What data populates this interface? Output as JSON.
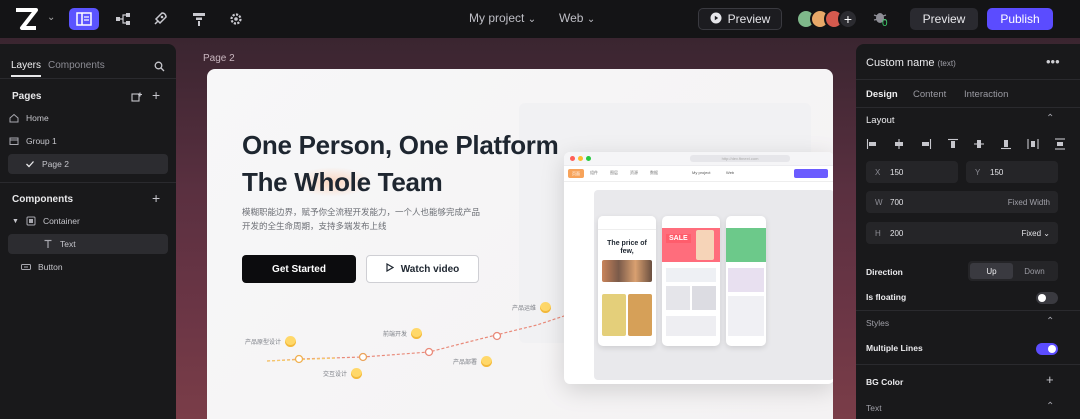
{
  "topbar": {
    "project_name": "My project",
    "platform": "Web",
    "preview_label": "Preview",
    "notification_count": "0",
    "preview_button_label": "Preview",
    "publish_label": "Publish",
    "avatar_add": "+"
  },
  "canvas": {
    "page_label": "Page 2"
  },
  "left_panel": {
    "tabs": [
      "Layers",
      "Components"
    ],
    "pages_title": "Pages",
    "pages": [
      "Home",
      "Group 1",
      "Page 2"
    ],
    "components_title": "Components",
    "components": [
      "Container",
      "Text",
      "Button"
    ]
  },
  "hero": {
    "title_line1": "One Person, One Platform",
    "title_line2_pre": "The ",
    "title_line2_glow": "Whole",
    "title_line2_post": " Team",
    "subtitle": "模糊职能边界，赋予你全流程开发能力，一个人也能够完成产品开发的全生命周期，支持多端发布上线",
    "start_button": "Get Started",
    "video_button": "Watch video"
  },
  "steps": [
    "产品原型设计",
    "交互设计",
    "前端开发",
    "产品部署",
    "产品运维"
  ],
  "mockup": {
    "url_text": "http://dev.fbnext.com",
    "toolbar_tabs": [
      "页面",
      "组件",
      "图层",
      "资源",
      "数据"
    ],
    "project": "My project",
    "web": "Web",
    "phone1_title": "The price of few,",
    "phone2_badge": "SALE"
  },
  "right_panel": {
    "title": "Custom name",
    "title_kind": "(text)",
    "more_icon": "•••",
    "tabs": [
      "Design",
      "Content",
      "Interaction"
    ],
    "layout_label": "Layout",
    "x_label": "X",
    "x_value": "150",
    "y_label": "Y",
    "y_value": "150",
    "w_label": "W",
    "w_value": "700",
    "w_mode": "Fixed Width",
    "h_label": "H",
    "h_value": "200",
    "h_mode": "Fixed",
    "direction_label": "Direction",
    "direction_options": [
      "Up",
      "Down"
    ],
    "floating_label": "Is floating",
    "floating_on": false,
    "styles_label": "Styles",
    "multiple_lines_label": "Multiple Lines",
    "multiple_lines_on": true,
    "bg_color_label": "BG Color",
    "text_label": "Text"
  },
  "colors": {
    "accent": "#5b4cff",
    "toggle_on": "#5b4cff",
    "success": "#3ed06c"
  },
  "icons": [
    "logo-icon",
    "layout-icon",
    "flow-icon",
    "deploy-icon",
    "component-icon",
    "settings-icon",
    "play-icon",
    "bug-icon",
    "search-icon",
    "add-page-icon",
    "plus-icon",
    "home-icon",
    "folder-icon",
    "check-icon",
    "container-icon",
    "text-icon",
    "button-icon",
    "caret-icon"
  ]
}
